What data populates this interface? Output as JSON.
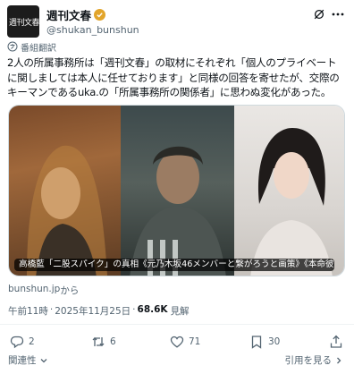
{
  "account": {
    "display_name": "週刊文春",
    "handle": "@shukan_bunshun",
    "avatar_text": "週刊文春",
    "verified_color": "#e2a52b"
  },
  "translation": {
    "label": "番組翻訳"
  },
  "tweet": {
    "lines": [
      "2人の所属事務所は「週刊文春」の取材にそれぞれ「個人のプライベート",
      "に関しましては本人に任せております」と同様の回答を寄せたが、交際の",
      "キーマンであるuka.の「所属事務所の関係者」に思わぬ変化があった。"
    ]
  },
  "card": {
    "caption": "高橋藍「二股スパイク」の真相《元乃木坂46メンバーと繋がろうと画策》《本命彼女は…"
  },
  "source": {
    "domain": "bunshun.jp",
    "suffix": " から"
  },
  "meta": {
    "time": "午前11時",
    "date": "2025年11月25日",
    "views_count": "68.6K",
    "views_label": "見解"
  },
  "actions": {
    "replies": "2",
    "reposts": "6",
    "likes": "71",
    "bookmarks": "30"
  },
  "footer": {
    "related_label": "関連性",
    "quotes_label": "引用を見る"
  },
  "icons": {
    "grok": "grok-icon",
    "more": "more-icon",
    "translate": "translate-icon",
    "reply": "reply-icon",
    "repost": "repost-icon",
    "like": "heart-icon",
    "bookmark": "bookmark-icon",
    "share": "share-icon",
    "chevron": "chevron-down-icon"
  },
  "colors": {
    "text_primary": "#0f1419",
    "text_secondary": "#536471",
    "border": "#cfd9de"
  }
}
